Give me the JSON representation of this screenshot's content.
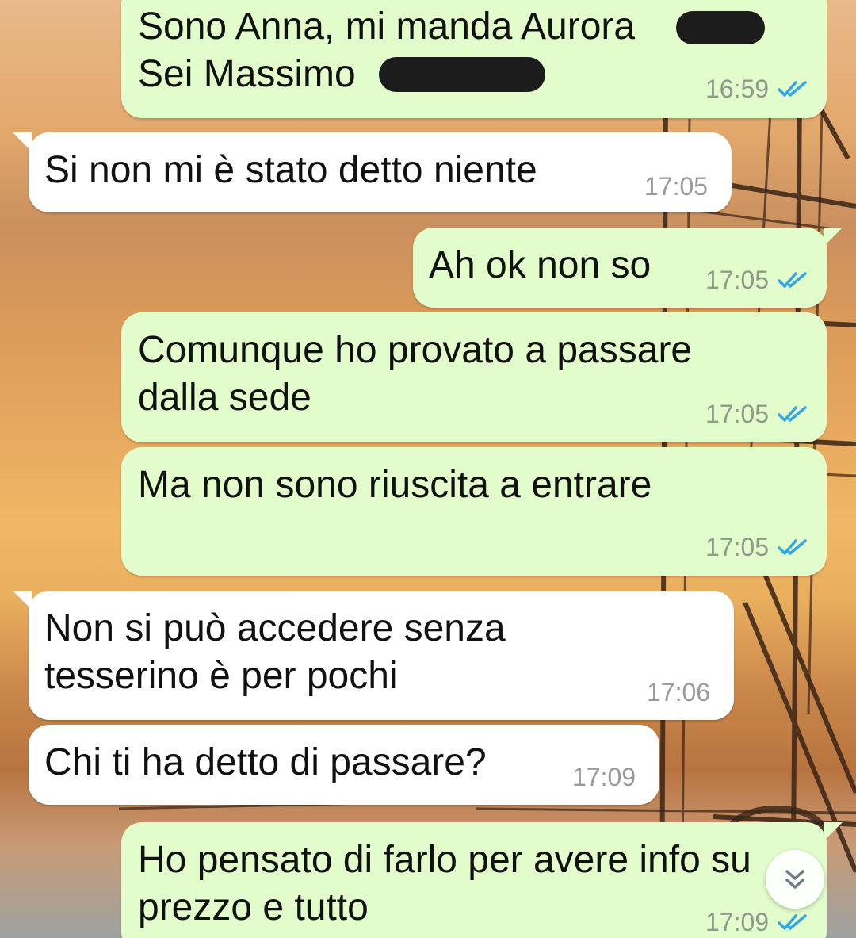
{
  "chat": {
    "messages": [
      {
        "direction": "out",
        "text": "Sono Anna, mi manda Aurora       \nSei Massimo              ?",
        "time": "16:59",
        "status": "read"
      },
      {
        "direction": "in",
        "text": "Si non mi è stato detto niente",
        "time": "17:05"
      },
      {
        "direction": "out",
        "text": "Ah ok non so",
        "time": "17:05",
        "status": "read"
      },
      {
        "direction": "out",
        "text": "Comunque ho provato a passare\ndalla sede",
        "time": "17:05",
        "status": "read"
      },
      {
        "direction": "out",
        "text": "Ma non sono riuscita a entrare",
        "time": "17:05",
        "status": "read"
      },
      {
        "direction": "in",
        "text": "Non si può accedere senza\ntesserino è per pochi",
        "time": "17:06"
      },
      {
        "direction": "in",
        "text": "Chi ti ha detto di passare?",
        "time": "17:09"
      },
      {
        "direction": "out",
        "text": "Ho pensato di farlo per avere info su\nprezzo e tutto",
        "time": "17:09",
        "status": "read"
      }
    ]
  },
  "scroll_button": {
    "icon": "double-chevron-down-icon"
  },
  "colors": {
    "outgoing_bubble": "#e2fdcb",
    "incoming_bubble": "#ffffff",
    "read_ticks": "#34a7e0",
    "timestamp": "#8f9a8c"
  }
}
